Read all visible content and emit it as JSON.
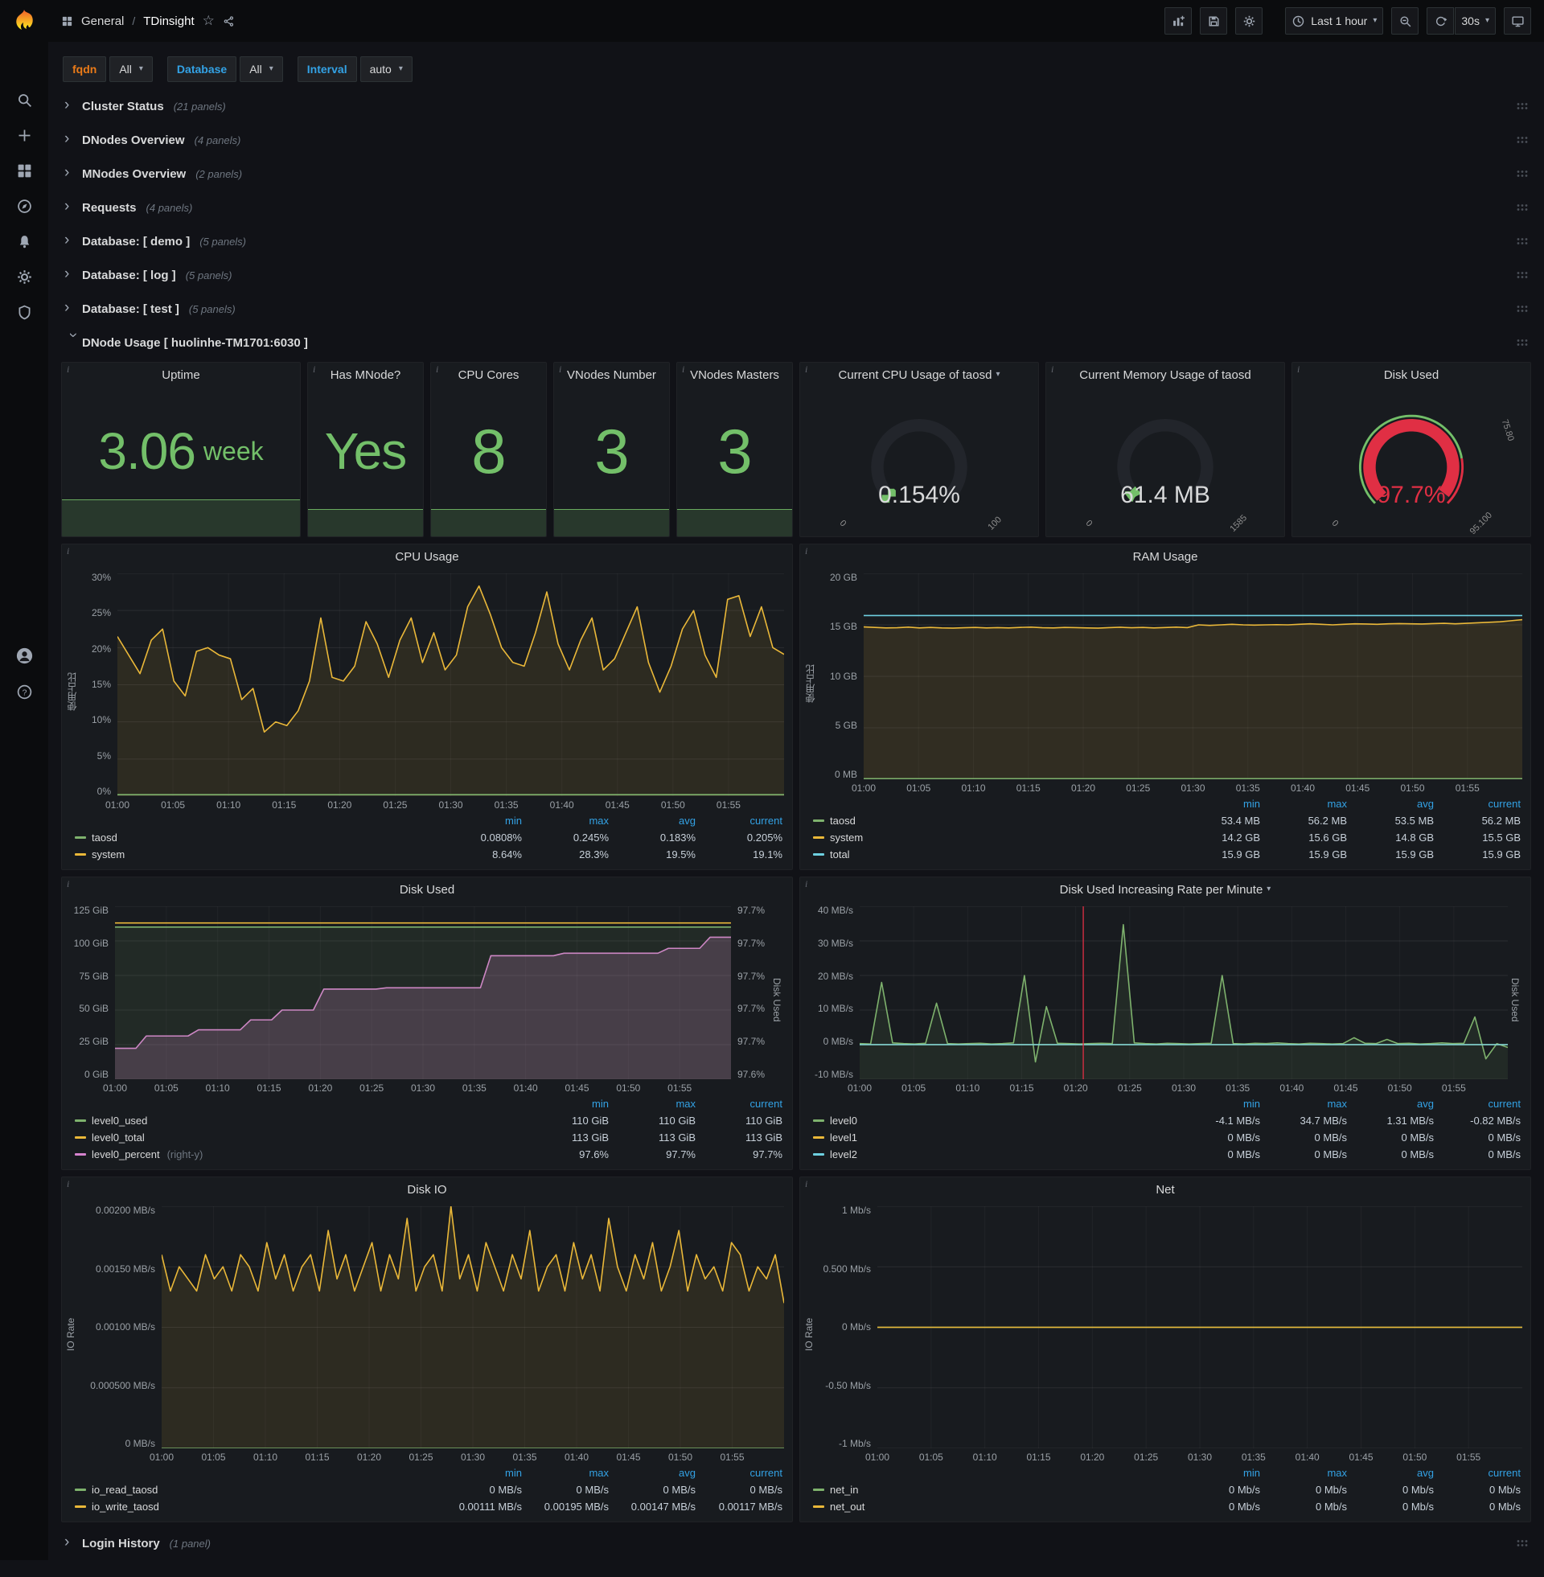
{
  "colors": {
    "green": "#73BF69",
    "series_green": "#7EB26D",
    "yellow": "#EAB839",
    "blue": "#6ED0E0",
    "pink": "#D683CE",
    "red": "#E02F44",
    "legend_header": "#33A2E5",
    "orange": "#EB7B18",
    "panel_bg": "#181B1F",
    "page_bg": "#111217"
  },
  "icons": {
    "chevron": "›",
    "caret_down": "▾",
    "star": "☆",
    "info": "i"
  },
  "nav": {
    "section": "General",
    "separator": "/",
    "title": "TDinsight",
    "time_range": "Last 1 hour",
    "refresh": "30s"
  },
  "variables": [
    {
      "label": "fqdn",
      "value": "All",
      "accent": "orange"
    },
    {
      "label": "Database",
      "value": "All",
      "accent": "blue"
    },
    {
      "label": "Interval",
      "value": "auto",
      "accent": "blue"
    }
  ],
  "collapsed_rows_top": [
    {
      "title": "Cluster Status",
      "count": "(21 panels)"
    },
    {
      "title": "DNodes Overview",
      "count": "(4 panels)"
    },
    {
      "title": "MNodes Overview",
      "count": "(2 panels)"
    },
    {
      "title": "Requests",
      "count": "(4 panels)"
    },
    {
      "title": "Database: [ demo ]",
      "count": "(5 panels)"
    },
    {
      "title": "Database: [ log ]",
      "count": "(5 panels)"
    },
    {
      "title": "Database: [ test ]",
      "count": "(5 panels)"
    }
  ],
  "dnode_row": {
    "title": "DNode Usage [ huolinhe-TM1701:6030 ]",
    "count": ""
  },
  "collapsed_rows_bottom": [
    {
      "title": "Login History",
      "count": "(1 panel)"
    }
  ],
  "stats": [
    {
      "title": "Uptime",
      "value": "3.06",
      "unit": "week",
      "span": 4,
      "spark": 46
    },
    {
      "title": "Has MNode?",
      "value": "Yes",
      "span": 2,
      "spark": 34
    },
    {
      "title": "CPU Cores",
      "value": "8",
      "span": 2,
      "spark": 34
    },
    {
      "title": "VNodes Number",
      "value": "3",
      "span": 2,
      "spark": 34
    },
    {
      "title": "VNodes Masters",
      "value": "3",
      "span": 2,
      "spark": 34
    }
  ],
  "gauges": [
    {
      "title": "Current CPU Usage of taosd",
      "caret": true,
      "value": "0.154%",
      "min": "0",
      "max": "100",
      "pct": 0.012,
      "color": "#73BF69",
      "value_color": "#D8D9DA",
      "ring": false
    },
    {
      "title": "Current Memory Usage of taosd",
      "caret": false,
      "value": "61.4 MB",
      "min": "0",
      "max": "1585",
      "pct": 0.039,
      "color": "#73BF69",
      "value_color": "#D8D9DA",
      "ring": false
    },
    {
      "title": "Disk Used",
      "caret": false,
      "value": "97.7%",
      "min": "0",
      "max": "95.100",
      "threshold_label": "75.80",
      "pct": 0.977,
      "color": "#E02F44",
      "value_color": "#E02F44",
      "ring": true,
      "ring_threshold": 0.797
    }
  ],
  "x_ticks": [
    "01:00",
    "01:05",
    "01:10",
    "01:15",
    "01:20",
    "01:25",
    "01:30",
    "01:35",
    "01:40",
    "01:45",
    "01:50",
    "01:55"
  ],
  "charts": [
    {
      "title": "CPU Usage",
      "caret": false,
      "y_label": "使用占比",
      "right_label": null,
      "y_ticks": [
        "30%",
        "25%",
        "20%",
        "15%",
        "10%",
        "5%",
        "0%"
      ],
      "right_ticks": null,
      "ymin": 0,
      "ymax": 30,
      "y_width": 46,
      "annotation_x": null,
      "series": [
        {
          "name": "system",
          "color": "#EAB839",
          "fill": 0.1,
          "values": [
            21.5,
            19,
            16.5,
            21,
            22.5,
            15.5,
            13.5,
            19.5,
            20,
            19,
            18.5,
            13,
            14.5,
            8.64,
            10,
            9.5,
            11.5,
            15.5,
            24,
            16,
            15.5,
            17.5,
            23.5,
            20.5,
            16,
            21,
            24,
            18,
            22,
            17,
            19,
            25.5,
            28.3,
            24.5,
            20,
            18,
            17.5,
            22,
            27.5,
            20.5,
            17,
            21,
            24,
            17,
            18.5,
            22,
            25.5,
            18,
            14,
            17.5,
            22.5,
            25,
            19,
            16,
            26.5,
            27,
            21.5,
            25.5,
            20,
            19.1
          ]
        },
        {
          "name": "taosd",
          "color": "#7EB26D",
          "values": [
            0.2,
            0.2
          ]
        }
      ],
      "legend": {
        "cols": [
          "min",
          "max",
          "avg",
          "current"
        ],
        "rows": [
          {
            "name": "taosd",
            "color": "#7EB26D",
            "values": [
              "0.0808%",
              "0.245%",
              "0.183%",
              "0.205%"
            ]
          },
          {
            "name": "system",
            "color": "#EAB839",
            "values": [
              "8.64%",
              "28.3%",
              "19.5%",
              "19.1%"
            ]
          }
        ]
      }
    },
    {
      "title": "RAM Usage",
      "caret": false,
      "y_label": "使用占比",
      "right_label": null,
      "y_ticks": [
        "20 GB",
        "15 GB",
        "10 GB",
        "5 GB",
        "0 MB"
      ],
      "right_ticks": null,
      "ymin": 0,
      "ymax": 20,
      "y_width": 56,
      "annotation_x": null,
      "series": [
        {
          "name": "system",
          "color": "#EAB839",
          "fill": 0.12,
          "values": [
            14.8,
            14.75,
            14.7,
            14.72,
            14.78,
            14.7,
            14.75,
            14.7,
            14.68,
            14.72,
            14.75,
            14.7,
            14.73,
            14.7,
            14.75,
            14.78,
            14.72,
            14.7,
            14.75,
            14.73,
            14.7,
            14.68,
            14.73,
            14.77,
            14.72,
            14.75,
            14.7,
            14.74,
            14.78,
            14.73,
            15.0,
            14.95,
            15.0,
            15.05,
            15.0,
            14.97,
            15.0,
            15.02,
            15.0,
            15.05,
            15.1,
            15.05,
            15.0,
            15.05,
            15.1,
            15.08,
            15.05,
            15.1,
            15.12,
            15.1,
            15.08,
            15.12,
            15.15,
            15.1,
            15.15,
            15.2,
            15.25,
            15.3,
            15.4,
            15.5
          ]
        },
        {
          "name": "total",
          "color": "#6ED0E0",
          "values": [
            15.9,
            15.9
          ]
        },
        {
          "name": "taosd",
          "color": "#7EB26D",
          "values": [
            0.055,
            0.055
          ]
        }
      ],
      "legend": {
        "cols": [
          "min",
          "max",
          "avg",
          "current"
        ],
        "rows": [
          {
            "name": "taosd",
            "color": "#7EB26D",
            "values": [
              "53.4 MB",
              "56.2 MB",
              "53.5 MB",
              "56.2 MB"
            ]
          },
          {
            "name": "system",
            "color": "#EAB839",
            "values": [
              "14.2 GB",
              "15.6 GB",
              "14.8 GB",
              "15.5 GB"
            ]
          },
          {
            "name": "total",
            "color": "#6ED0E0",
            "values": [
              "15.9 GB",
              "15.9 GB",
              "15.9 GB",
              "15.9 GB"
            ]
          }
        ]
      }
    },
    {
      "title": "Disk Used",
      "caret": false,
      "y_label": null,
      "right_label": "Disk Used",
      "y_ticks": [
        "125 GiB",
        "100 GiB",
        "75 GiB",
        "50 GiB",
        "25 GiB",
        "0 GiB"
      ],
      "right_ticks": [
        "97.7%",
        "97.7%",
        "97.7%",
        "97.7%",
        "97.7%",
        "97.6%"
      ],
      "ymin": 0,
      "ymax": 125,
      "rmin": 97.585,
      "rmax": 97.725,
      "y_width": 62,
      "r_width": 48,
      "annotation_x": null,
      "series": [
        {
          "name": "level0_percent",
          "color": "#D683CE",
          "fill": 0.22,
          "axis": "right",
          "values": [
            97.61,
            97.61,
            97.61,
            97.62,
            97.62,
            97.62,
            97.62,
            97.62,
            97.625,
            97.625,
            97.625,
            97.625,
            97.625,
            97.633,
            97.633,
            97.633,
            97.641,
            97.641,
            97.641,
            97.641,
            97.658,
            97.658,
            97.658,
            97.658,
            97.658,
            97.658,
            97.659,
            97.659,
            97.659,
            97.659,
            97.659,
            97.659,
            97.659,
            97.659,
            97.659,
            97.659,
            97.685,
            97.685,
            97.685,
            97.685,
            97.685,
            97.685,
            97.685,
            97.687,
            97.687,
            97.687,
            97.687,
            97.687,
            97.687,
            97.687,
            97.687,
            97.687,
            97.687,
            97.691,
            97.691,
            97.691,
            97.691,
            97.7,
            97.7,
            97.7
          ]
        },
        {
          "name": "level0_used",
          "color": "#7EB26D",
          "fill": 0.1,
          "values": [
            110,
            110
          ]
        },
        {
          "name": "level0_total",
          "color": "#EAB839",
          "values": [
            113,
            113
          ]
        }
      ],
      "legend": {
        "cols": [
          "min",
          "max",
          "current"
        ],
        "rows": [
          {
            "name": "level0_used",
            "color": "#7EB26D",
            "values": [
              "110 GiB",
              "110 GiB",
              "110 GiB"
            ]
          },
          {
            "name": "level0_total",
            "color": "#EAB839",
            "values": [
              "113 GiB",
              "113 GiB",
              "113 GiB"
            ]
          },
          {
            "name": "level0_percent",
            "color": "#D683CE",
            "note": "(right-y)",
            "values": [
              "97.6%",
              "97.7%",
              "97.7%"
            ]
          }
        ]
      }
    },
    {
      "title": "Disk Used Increasing Rate per Minute",
      "caret": true,
      "y_label": null,
      "right_label": "Disk Used",
      "y_ticks": [
        "40 MB/s",
        "30 MB/s",
        "20 MB/s",
        "10 MB/s",
        "0 MB/s",
        "-10 MB/s"
      ],
      "right_ticks": null,
      "ymin": -10,
      "ymax": 40,
      "y_width": 70,
      "annotation_x": 0.345,
      "series": [
        {
          "name": "level0",
          "color": "#7EB26D",
          "fill": 0.1,
          "values": [
            0.3,
            0.2,
            18,
            0.5,
            0.3,
            0.2,
            0.4,
            12,
            0.3,
            0.2,
            0.3,
            0.4,
            0.2,
            0.3,
            0.5,
            20,
            -5,
            11,
            0.4,
            0.3,
            0.2,
            0.3,
            0.4,
            0.3,
            34.7,
            0.5,
            0.3,
            0.2,
            0.4,
            0.3,
            0.2,
            0.3,
            0.4,
            20,
            0.3,
            0.2,
            0.4,
            0.3,
            0.5,
            0.3,
            0.2,
            0.4,
            0.3,
            0.2,
            0.3,
            2,
            0.4,
            0.3,
            1.5,
            0.3,
            0.4,
            0.2,
            0.3,
            0.5,
            0.3,
            0.4,
            8,
            -4.1,
            0.3,
            -0.82
          ]
        },
        {
          "name": "level1",
          "color": "#EAB839",
          "values": [
            0,
            0
          ]
        },
        {
          "name": "level2",
          "color": "#6ED0E0",
          "values": [
            0,
            0
          ]
        }
      ],
      "legend": {
        "cols": [
          "min",
          "max",
          "avg",
          "current"
        ],
        "rows": [
          {
            "name": "level0",
            "color": "#7EB26D",
            "values": [
              "-4.1 MB/s",
              "34.7 MB/s",
              "1.31 MB/s",
              "-0.82 MB/s"
            ]
          },
          {
            "name": "level1",
            "color": "#EAB839",
            "values": [
              "0 MB/s",
              "0 MB/s",
              "0 MB/s",
              "0 MB/s"
            ]
          },
          {
            "name": "level2",
            "color": "#6ED0E0",
            "values": [
              "0 MB/s",
              "0 MB/s",
              "0 MB/s",
              "0 MB/s"
            ]
          }
        ]
      }
    },
    {
      "title": "Disk IO",
      "caret": false,
      "y_label": "IO Rate",
      "right_label": null,
      "y_ticks": [
        "0.00200 MB/s",
        "0.00150 MB/s",
        "0.00100 MB/s",
        "0.000500 MB/s",
        "0 MB/s"
      ],
      "right_ticks": null,
      "ymin": 0,
      "ymax": 0.002,
      "y_width": 104,
      "annotation_x": null,
      "series": [
        {
          "name": "io_write_taosd",
          "color": "#EAB839",
          "fill": 0.1,
          "values": [
            0.0016,
            0.0013,
            0.0015,
            0.0014,
            0.0013,
            0.0016,
            0.0014,
            0.0015,
            0.0013,
            0.0016,
            0.0015,
            0.0013,
            0.0017,
            0.0014,
            0.0016,
            0.0013,
            0.0015,
            0.0016,
            0.0013,
            0.0018,
            0.0014,
            0.0016,
            0.0013,
            0.0015,
            0.0017,
            0.0013,
            0.0016,
            0.0014,
            0.0019,
            0.0013,
            0.0015,
            0.0016,
            0.0013,
            0.002,
            0.0014,
            0.0016,
            0.0013,
            0.0017,
            0.0015,
            0.0013,
            0.0016,
            0.0014,
            0.0018,
            0.0013,
            0.0015,
            0.0016,
            0.0013,
            0.0017,
            0.0014,
            0.0016,
            0.0013,
            0.0019,
            0.0015,
            0.0013,
            0.0016,
            0.0014,
            0.0017,
            0.0013,
            0.0015,
            0.0018,
            0.0013,
            0.0016,
            0.0014,
            0.0015,
            0.0013,
            0.0017,
            0.0016,
            0.0013,
            0.0015,
            0.0014,
            0.0016,
            0.0012
          ]
        },
        {
          "name": "io_read_taosd",
          "color": "#7EB26D",
          "values": [
            0,
            0
          ]
        }
      ],
      "legend": {
        "cols": [
          "min",
          "max",
          "avg",
          "current"
        ],
        "rows": [
          {
            "name": "io_read_taosd",
            "color": "#7EB26D",
            "values": [
              "0 MB/s",
              "0 MB/s",
              "0 MB/s",
              "0 MB/s"
            ]
          },
          {
            "name": "io_write_taosd",
            "color": "#EAB839",
            "values": [
              "0.00111 MB/s",
              "0.00195 MB/s",
              "0.00147 MB/s",
              "0.00117 MB/s"
            ]
          }
        ]
      }
    },
    {
      "title": "Net",
      "caret": false,
      "y_label": "IO Rate",
      "right_label": null,
      "y_ticks": [
        "1 Mb/s",
        "0.500 Mb/s",
        "0 Mb/s",
        "-0.50 Mb/s",
        "-1 Mb/s"
      ],
      "right_ticks": null,
      "ymin": -1,
      "ymax": 1,
      "y_width": 76,
      "annotation_x": null,
      "series": [
        {
          "name": "net_in",
          "color": "#7EB26D",
          "values": [
            0,
            0
          ]
        },
        {
          "name": "net_out",
          "color": "#EAB839",
          "values": [
            0,
            0
          ]
        }
      ],
      "legend": {
        "cols": [
          "min",
          "max",
          "avg",
          "current"
        ],
        "rows": [
          {
            "name": "net_in",
            "color": "#7EB26D",
            "values": [
              "0 Mb/s",
              "0 Mb/s",
              "0 Mb/s",
              "0 Mb/s"
            ]
          },
          {
            "name": "net_out",
            "color": "#EAB839",
            "values": [
              "0 Mb/s",
              "0 Mb/s",
              "0 Mb/s",
              "0 Mb/s"
            ]
          }
        ]
      }
    }
  ]
}
